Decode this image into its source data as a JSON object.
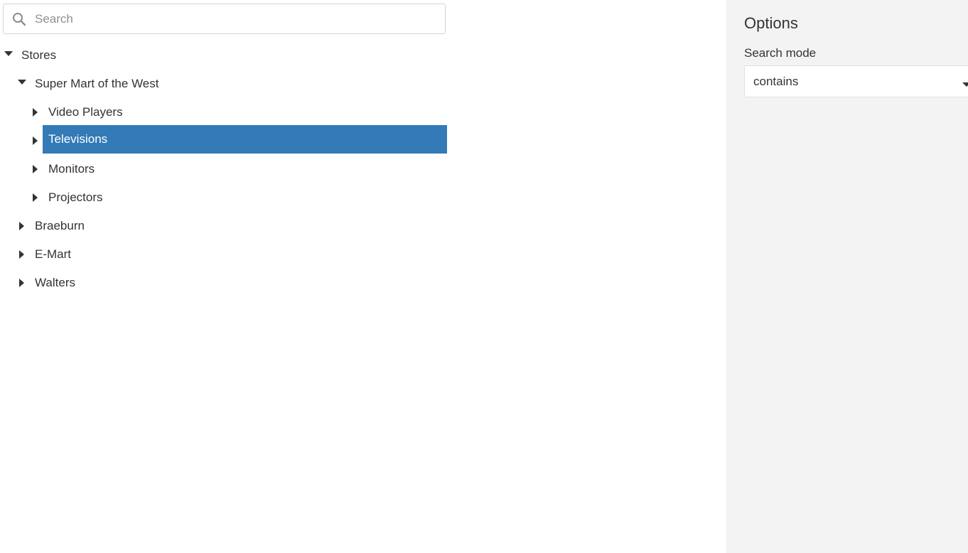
{
  "search": {
    "placeholder": "Search",
    "value": ""
  },
  "tree": {
    "root": {
      "label": "Stores",
      "expanded": true,
      "children": [
        {
          "label": "Super Mart of the West",
          "expanded": true,
          "children": [
            {
              "label": "Video Players",
              "expanded": false
            },
            {
              "label": "Televisions",
              "expanded": false,
              "selected": true
            },
            {
              "label": "Monitors",
              "expanded": false
            },
            {
              "label": "Projectors",
              "expanded": false
            }
          ]
        },
        {
          "label": "Braeburn",
          "expanded": false
        },
        {
          "label": "E-Mart",
          "expanded": false
        },
        {
          "label": "Walters",
          "expanded": false
        }
      ]
    }
  },
  "options": {
    "title": "Options",
    "search_mode_label": "Search mode",
    "search_mode_value": "contains"
  },
  "colors": {
    "selected_bg": "#337ab7",
    "selected_text": "#ffffff",
    "options_bg": "#f3f3f3"
  },
  "icons": {
    "search": "search-icon",
    "expanded": "caret-down-icon",
    "collapsed": "caret-right-icon",
    "dropdown": "caret-down-icon"
  }
}
